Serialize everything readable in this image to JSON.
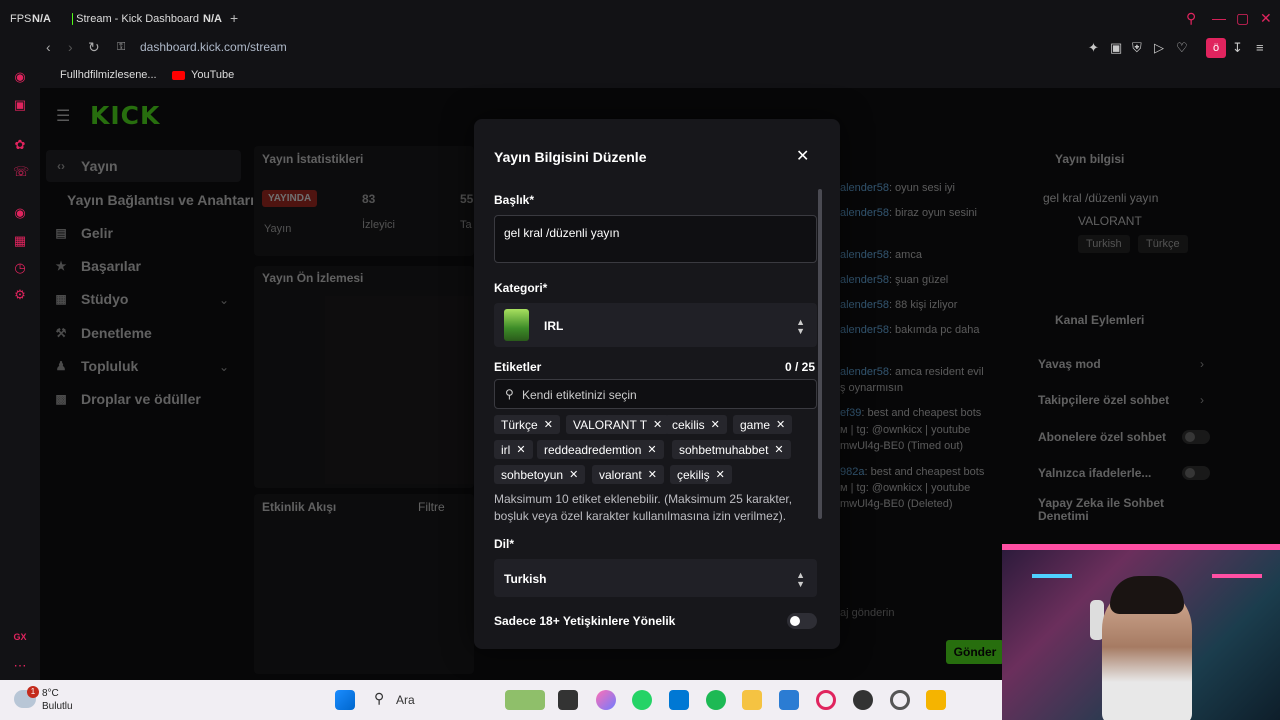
{
  "browser": {
    "tabs": [
      {
        "label": "FPS"
      },
      {
        "label": "N/A"
      },
      {
        "label": "Stream - Kick Dashboard"
      },
      {
        "label": "N/A"
      }
    ],
    "url": "dashboard.kick.com/stream",
    "bookmarks": [
      {
        "label": "Fullhdfilmizlesene..."
      },
      {
        "label": "YouTube"
      }
    ],
    "profile_letter": "ö"
  },
  "sidebar": {
    "logo": "KICK",
    "items": [
      {
        "label": "Yayın"
      },
      {
        "label": "Yayın Bağlantısı ve Anahtarı"
      },
      {
        "label": "Gelir"
      },
      {
        "label": "Başarılar"
      },
      {
        "label": "Stüdyo"
      },
      {
        "label": "Denetleme"
      },
      {
        "label": "Topluluk"
      },
      {
        "label": "Droplar ve ödüller"
      }
    ]
  },
  "stats_panel": {
    "title": "Yayın İstatistikleri",
    "live_badge": "YAYINDA",
    "live_label": "Yayın",
    "viewers_value": "83",
    "viewers_label": "İzleyici",
    "third_value": "55",
    "third_label": "Ta"
  },
  "preview_panel": {
    "title": "Yayın Ön İzlemesi"
  },
  "activity_panel": {
    "title": "Etkinlik Akışı",
    "filter": "Filtre"
  },
  "chat": {
    "lines": [
      {
        "user": "alender58",
        "text": ": oyun sesi iyi"
      },
      {
        "user": "alender58",
        "text": ": biraz oyun sesini"
      },
      {
        "user": "alender58",
        "text": ": amca"
      },
      {
        "user": "alender58",
        "text": ": şuan güzel"
      },
      {
        "user": "alender58",
        "text": ": 88 kişi izliyor"
      },
      {
        "user": "alender58",
        "text": ": bakımda pc daha"
      },
      {
        "user": "alender58",
        "text": ": amca resident evil"
      },
      {
        "user": "",
        "text": "ş oynarmısın"
      },
      {
        "user": "ef39",
        "text": ": best and cheapest bots"
      },
      {
        "user": "",
        "text": "м | tg: @ownkicx | youtube"
      },
      {
        "user": "",
        "text": "mwUl4g-BE0 (Timed out)"
      },
      {
        "user": "982a",
        "text": ": best and cheapest bots"
      },
      {
        "user": "",
        "text": "м | tg: @ownkicx | youtube"
      },
      {
        "user": "",
        "text": "mwUl4g-BE0 (Deleted)"
      }
    ],
    "send_label": "Gönder",
    "input_placeholder": "aj gönderin"
  },
  "right_panel": {
    "info_title": "Yayın bilgisi",
    "stream_title": "gel kral /düzenli yayın",
    "game": "VALORANT",
    "chips": [
      "Turkish",
      "Türkçe"
    ],
    "actions_title": "Kanal Eylemleri",
    "actions": [
      {
        "label": "Yavaş mod"
      },
      {
        "label": "Takipçilere özel sohbet"
      },
      {
        "label": "Abonelere özel sohbet"
      },
      {
        "label": "Yalnızca ifadelerle..."
      },
      {
        "label": "Yapay Zeka ile Sohbet Denetimi"
      }
    ]
  },
  "modal": {
    "title": "Yayın Bilgisini Düzenle",
    "title_label": "Başlık*",
    "title_value": "gel kral /düzenli yayın",
    "category_label": "Kategori*",
    "category_value": "IRL",
    "tags_label": "Etiketler",
    "tags_count": "0 / 25",
    "tags_placeholder": "Kendi etiketinizi seçin",
    "tags": [
      {
        "label": "Türkçe"
      },
      {
        "label": "VALORANT T"
      },
      {
        "label": "cekilis"
      },
      {
        "label": "game"
      },
      {
        "label": "irl"
      },
      {
        "label": "reddeadredemtion"
      },
      {
        "label": "sohbetmuhabbet"
      },
      {
        "label": "sohbetoyun"
      },
      {
        "label": "valorant"
      },
      {
        "label": "çekiliş"
      }
    ],
    "hint": "Maksimum 10 etiket eklenebilir. (Maksimum 25 karakter, boşluk veya özel karakter kullanılmasına izin verilmez).",
    "language_label": "Dil*",
    "language_value": "Turkish",
    "adult_label": "Sadece 18+ Yetişkinlere Yönelik",
    "adult_enabled": false
  },
  "taskbar": {
    "weather_temp": "8°C",
    "weather_desc": "Bulutlu",
    "notification_count": "1",
    "search_label": "Ara"
  },
  "colors": {
    "kick_green": "#53fc18",
    "accent_pink": "#e0245e"
  }
}
